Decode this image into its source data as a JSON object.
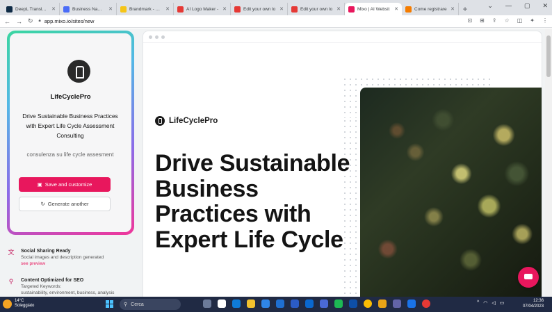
{
  "browser": {
    "tabs": [
      {
        "title": "DeepL Translate: ",
        "icon": "deepl-icon",
        "color": "#0f2b46"
      },
      {
        "title": "Business Name G",
        "icon": "business-name-icon",
        "color": "#4a6cf7"
      },
      {
        "title": "Brandmark - mos",
        "icon": "brandmark-icon",
        "color": "#f5c518"
      },
      {
        "title": "AI Logo Maker - ",
        "icon": "logo-maker-icon",
        "color": "#e53935"
      },
      {
        "title": "Edit your own lo",
        "icon": "logo-maker-icon",
        "color": "#e53935"
      },
      {
        "title": "Edit your own lo",
        "icon": "logo-maker-icon",
        "color": "#e53935"
      },
      {
        "title": "Mixo | AI Websit",
        "icon": "mixo-icon",
        "color": "#e8175d",
        "active": true
      },
      {
        "title": "Come registrare ",
        "icon": "orange-site-icon",
        "color": "#f57c00"
      }
    ],
    "url": "app.mixo.io/sites/new"
  },
  "sidebar": {
    "brand": "LifeCyclePro",
    "tagline": "Drive Sustainable Business Practices with Expert Life Cycle Assessment Consulting",
    "prompt": "consulenza su life cycle assesment",
    "save_label": "Save and customize",
    "generate_label": "Generate another",
    "features": [
      {
        "title": "Social Sharing Ready",
        "desc": "Social images and description generated",
        "link": "see preview",
        "icon": "translate-icon"
      },
      {
        "title": "Content Optimized for SEO",
        "desc": "Targeted Keywords:",
        "extra": "sustainability, environment, business, analysis",
        "icon": "seo-icon"
      }
    ]
  },
  "preview": {
    "brand": "LifeCyclePro",
    "headline": "Drive Sustainable Business Practices with Expert Life Cycle"
  },
  "taskbar": {
    "temperature": "14°C",
    "weather": "Soleggiato",
    "search": "Cerca",
    "time": "12:36",
    "date": "07/04/2023"
  }
}
